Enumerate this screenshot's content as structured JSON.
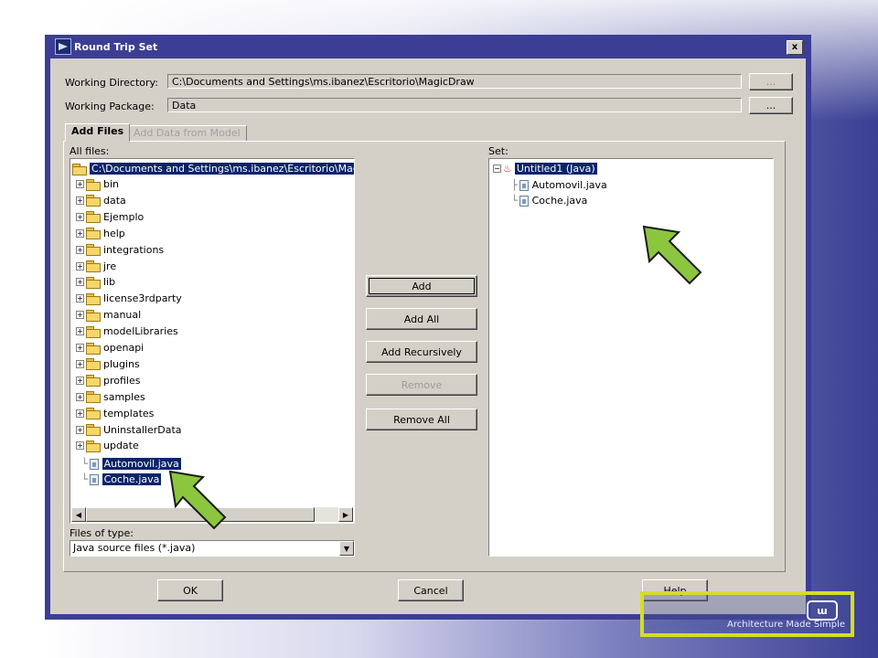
{
  "window": {
    "title": "Round Trip Set",
    "close_glyph": "x"
  },
  "form": {
    "working_directory_label": "Working Directory:",
    "working_directory_value": "C:\\Documents and Settings\\ms.ibanez\\Escritorio\\MagicDraw",
    "working_package_label": "Working Package:",
    "working_package_value": "Data",
    "browse_label": "..."
  },
  "tabs": [
    {
      "label": "Add Files",
      "active": true
    },
    {
      "label": "Add Data from Model",
      "active": false
    }
  ],
  "all_files": {
    "label": "All files:",
    "root": "C:\\Documents and Settings\\ms.ibanez\\Escritorio\\Magic",
    "folders": [
      "bin",
      "data",
      "Ejemplo",
      "help",
      "integrations",
      "jre",
      "lib",
      "license3rdparty",
      "manual",
      "modelLibraries",
      "openapi",
      "plugins",
      "profiles",
      "samples",
      "templates",
      "UninstallerData",
      "update"
    ],
    "files": [
      "Automovil.java",
      "Coche.java"
    ],
    "files_of_type_label": "Files of type:",
    "files_of_type_value": "Java source files (*.java)"
  },
  "actions": {
    "add": "Add",
    "add_all": "Add All",
    "add_recursively": "Add Recursively",
    "remove": "Remove",
    "remove_all": "Remove All"
  },
  "set": {
    "label": "Set:",
    "root": "Untitled1 (Java)",
    "files": [
      "Automovil.java",
      "Coche.java"
    ]
  },
  "footer": {
    "ok": "OK",
    "cancel": "Cancel",
    "help": "Help"
  },
  "branding": {
    "tagline": "Architecture Made Simple",
    "mark": "ɯ"
  },
  "colors": {
    "title_bar": "#3c3e95",
    "selection": "#0a246a",
    "highlight_arrow": "#8cc63e",
    "logo_border": "#d6dd26"
  }
}
